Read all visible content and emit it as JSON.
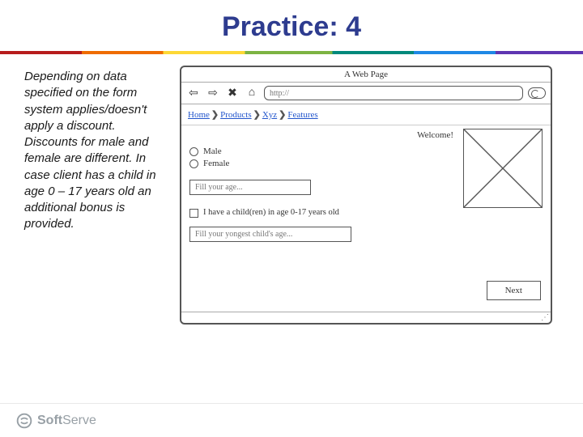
{
  "title": "Practice: 4",
  "description": "Depending on data specified on the form system applies/doesn't apply a discount. Discounts for male and female are different. In case client has a child in age 0 – 17 years old an additional bonus is provided.",
  "mock": {
    "window_title": "A Web Page",
    "url_placeholder": "http://",
    "breadcrumbs": [
      "Home",
      "Products",
      "Xyz",
      "Features"
    ],
    "welcome": "Welcome!",
    "radios": {
      "male": "Male",
      "female": "Female"
    },
    "age_placeholder": "Fill your age...",
    "checkbox_label": "I have a child(ren) in age 0-17 years old",
    "child_age_placeholder": "Fill your yongest child's age...",
    "next_button": "Next"
  },
  "brand": {
    "prefix": "Soft",
    "suffix": "Serve"
  }
}
